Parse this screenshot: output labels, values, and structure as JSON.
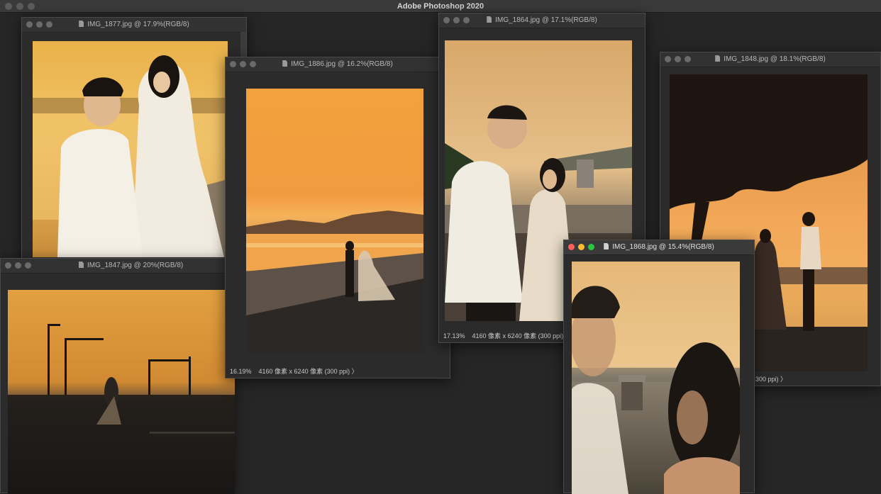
{
  "app": {
    "title": "Adobe Photoshop 2020"
  },
  "documents": {
    "img1877": {
      "title": "IMG_1877.jpg @ 17.9%(RGB/8)"
    },
    "img1847": {
      "title": "IMG_1847.jpg @ 20%(RGB/8)"
    },
    "img1886": {
      "title": "IMG_1886.jpg @ 16.2%(RGB/8)",
      "zoom": "16.19%",
      "size": "4160 像素 x 6240 像素 (300 ppi)",
      "chevron": "〉"
    },
    "img1864": {
      "title": "IMG_1864.jpg @ 17.1%(RGB/8)",
      "zoom": "17.13%",
      "size": "4160 像素 x 6240 像素 (300 ppi)",
      "chevron": "〉"
    },
    "img1848": {
      "title": "IMG_1848.jpg @ 18.1%(RGB/8)",
      "size_partial": "300 ppi)",
      "chevron": "〉"
    },
    "img1868": {
      "title": "IMG_1868.jpg @ 15.4%(RGB/8)"
    }
  },
  "colors": {
    "close": "#fe5f57",
    "minimize": "#febc2e",
    "zoom": "#28c840",
    "window_bg": "#2b2b2b"
  }
}
